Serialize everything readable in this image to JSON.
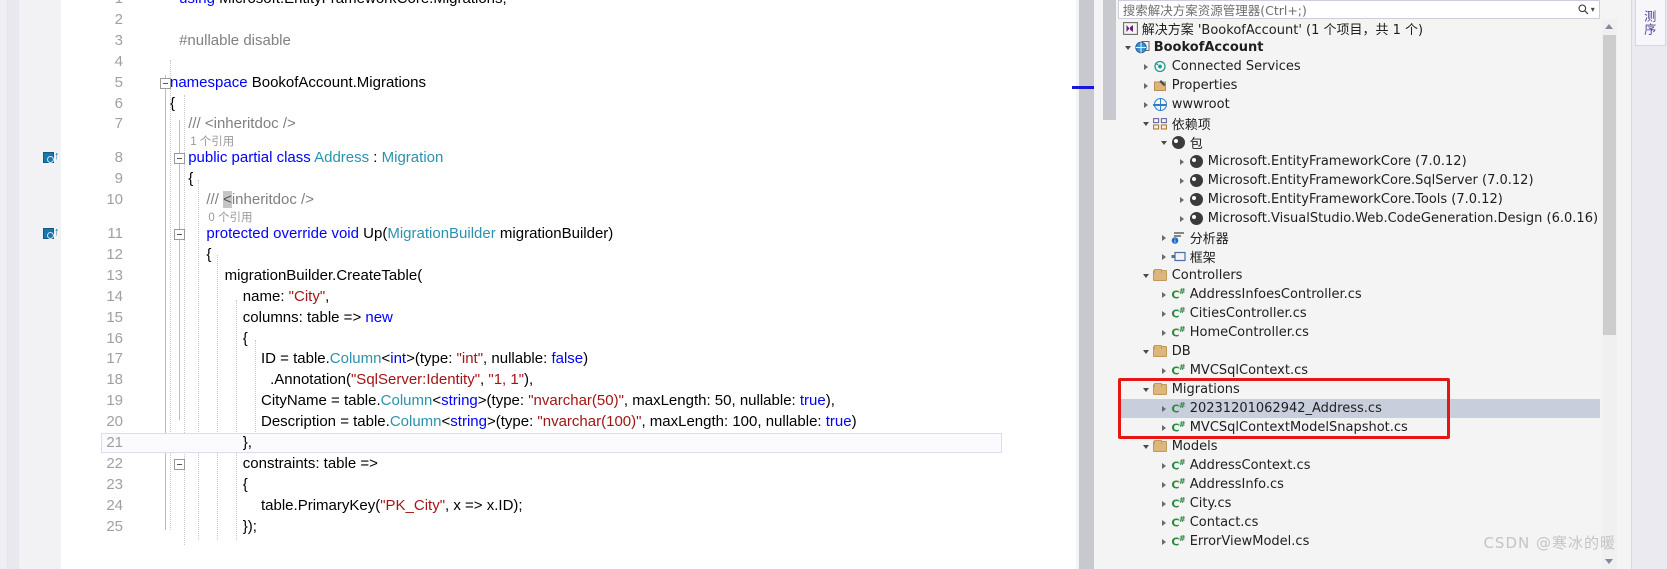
{
  "editor": {
    "first_line_number": 1,
    "lines": [
      {
        "n": "1",
        "kind": "partial-top",
        "tokens": [
          {
            "t": "using",
            "c": "kw"
          },
          {
            "t": " Microsoft.EntityFrameworkCore.Migrations;",
            "c": "pl"
          }
        ]
      },
      {
        "n": "2",
        "tokens": []
      },
      {
        "n": "3",
        "tokens": [
          {
            "t": "#nullable disable",
            "c": "pp"
          }
        ]
      },
      {
        "n": "4",
        "tokens": []
      },
      {
        "n": "5",
        "tokens": [
          {
            "t": "namespace",
            "c": "kw"
          },
          {
            "t": " BookofAccount.Migrations",
            "c": "pl"
          }
        ]
      },
      {
        "n": "6",
        "tokens": [
          {
            "t": "{",
            "c": "pl"
          }
        ]
      },
      {
        "n": "7",
        "tokens": [
          {
            "t": "/// <inheritdoc />",
            "c": "cmt"
          }
        ]
      },
      {
        "n": "8",
        "tokens": [
          {
            "t": "public partial class",
            "c": "kw"
          },
          {
            "t": " ",
            "c": "pl"
          },
          {
            "t": "Address",
            "c": "typ"
          },
          {
            "t": " : ",
            "c": "pl"
          },
          {
            "t": "Migration",
            "c": "typ"
          }
        ]
      },
      {
        "n": "9",
        "tokens": [
          {
            "t": "{",
            "c": "pl"
          }
        ]
      },
      {
        "n": "10",
        "tokens": [
          {
            "t": "/// ",
            "c": "cmt"
          },
          {
            "t": "<",
            "c": "sel-sq"
          },
          {
            "t": "inheritdoc />",
            "c": "cmt"
          }
        ]
      },
      {
        "n": "11",
        "tokens": [
          {
            "t": "protected override void",
            "c": "kw"
          },
          {
            "t": " ",
            "c": "pl"
          },
          {
            "t": "Up",
            "c": "pl"
          },
          {
            "t": "(",
            "c": "pl"
          },
          {
            "t": "MigrationBuilder",
            "c": "typ"
          },
          {
            "t": " migrationBuilder)",
            "c": "pl"
          }
        ]
      },
      {
        "n": "12",
        "tokens": [
          {
            "t": "{",
            "c": "pl"
          }
        ]
      },
      {
        "n": "13",
        "tokens": [
          {
            "t": "migrationBuilder.CreateTable(",
            "c": "pl"
          }
        ]
      },
      {
        "n": "14",
        "tokens": [
          {
            "t": "name: ",
            "c": "pl"
          },
          {
            "t": "\"City\"",
            "c": "str"
          },
          {
            "t": ",",
            "c": "pl"
          }
        ]
      },
      {
        "n": "15",
        "tokens": [
          {
            "t": "columns: table => ",
            "c": "pl"
          },
          {
            "t": "new",
            "c": "kw"
          }
        ]
      },
      {
        "n": "16",
        "tokens": [
          {
            "t": "{",
            "c": "pl"
          }
        ]
      },
      {
        "n": "17",
        "tokens": [
          {
            "t": "ID = table.",
            "c": "pl"
          },
          {
            "t": "Column",
            "c": "typ"
          },
          {
            "t": "<",
            "c": "pl"
          },
          {
            "t": "int",
            "c": "kw"
          },
          {
            "t": ">(type: ",
            "c": "pl"
          },
          {
            "t": "\"int\"",
            "c": "str"
          },
          {
            "t": ", nullable: ",
            "c": "pl"
          },
          {
            "t": "false",
            "c": "kw"
          },
          {
            "t": ")",
            "c": "pl"
          }
        ]
      },
      {
        "n": "18",
        "tokens": [
          {
            "t": ".Annotation(",
            "c": "pl"
          },
          {
            "t": "\"SqlServer:Identity\"",
            "c": "str"
          },
          {
            "t": ", ",
            "c": "pl"
          },
          {
            "t": "\"1, 1\"",
            "c": "str"
          },
          {
            "t": "),",
            "c": "pl"
          }
        ]
      },
      {
        "n": "19",
        "tokens": [
          {
            "t": "CityName = table.",
            "c": "pl"
          },
          {
            "t": "Column",
            "c": "typ"
          },
          {
            "t": "<",
            "c": "pl"
          },
          {
            "t": "string",
            "c": "kw"
          },
          {
            "t": ">(type: ",
            "c": "pl"
          },
          {
            "t": "\"nvarchar(50)\"",
            "c": "str"
          },
          {
            "t": ", maxLength: 50, nullable: ",
            "c": "pl"
          },
          {
            "t": "true",
            "c": "kw"
          },
          {
            "t": "),",
            "c": "pl"
          }
        ]
      },
      {
        "n": "20",
        "tokens": [
          {
            "t": "Description = table.",
            "c": "pl"
          },
          {
            "t": "Column",
            "c": "typ"
          },
          {
            "t": "<",
            "c": "pl"
          },
          {
            "t": "string",
            "c": "kw"
          },
          {
            "t": ">(type: ",
            "c": "pl"
          },
          {
            "t": "\"nvarchar(100)\"",
            "c": "str"
          },
          {
            "t": ", maxLength: 100, nullable: ",
            "c": "pl"
          },
          {
            "t": "true",
            "c": "kw"
          },
          {
            "t": ")",
            "c": "pl"
          }
        ]
      },
      {
        "n": "21",
        "tokens": [
          {
            "t": "},",
            "c": "pl"
          }
        ]
      },
      {
        "n": "22",
        "tokens": [
          {
            "t": "constraints: table =>",
            "c": "pl"
          }
        ]
      },
      {
        "n": "23",
        "tokens": [
          {
            "t": "{",
            "c": "pl"
          }
        ]
      },
      {
        "n": "24",
        "tokens": [
          {
            "t": "table.PrimaryKey(",
            "c": "pl"
          },
          {
            "t": "\"PK_City\"",
            "c": "str"
          },
          {
            "t": ", x => x.ID);",
            "c": "pl"
          }
        ]
      },
      {
        "n": "25",
        "tokens": [
          {
            "t": "});",
            "c": "pl"
          }
        ]
      }
    ],
    "codelens": [
      {
        "for_line": "8",
        "text": "1 个引用"
      },
      {
        "for_line": "11",
        "text": "0 个引用"
      }
    ]
  },
  "solution_explorer": {
    "search": {
      "placeholder": "搜索解决方案资源管理器(Ctrl+;)",
      "value": ""
    },
    "solution_node": {
      "label": "解决方案 'BookofAccount' (1 个项目，共 1 个)"
    },
    "tree": [
      {
        "depth": 0,
        "twisty": "down",
        "icon": "project-icon",
        "label": "BookofAccount",
        "bold": true
      },
      {
        "depth": 1,
        "twisty": "right",
        "icon": "connected-services-icon",
        "label": "Connected Services"
      },
      {
        "depth": 1,
        "twisty": "right",
        "icon": "properties-icon",
        "label": "Properties"
      },
      {
        "depth": 1,
        "twisty": "right",
        "icon": "globe-icon",
        "label": "wwwroot"
      },
      {
        "depth": 1,
        "twisty": "down",
        "icon": "dependencies-icon",
        "label": "依赖项"
      },
      {
        "depth": 2,
        "twisty": "down",
        "icon": "package-icon",
        "label": "包"
      },
      {
        "depth": 3,
        "twisty": "right",
        "icon": "package-icon",
        "label": "Microsoft.EntityFrameworkCore (7.0.12)"
      },
      {
        "depth": 3,
        "twisty": "right",
        "icon": "package-icon",
        "label": "Microsoft.EntityFrameworkCore.SqlServer (7.0.12)"
      },
      {
        "depth": 3,
        "twisty": "right",
        "icon": "package-icon",
        "label": "Microsoft.EntityFrameworkCore.Tools (7.0.12)"
      },
      {
        "depth": 3,
        "twisty": "right",
        "icon": "package-icon",
        "label": "Microsoft.VisualStudio.Web.CodeGeneration.Design (6.0.16)"
      },
      {
        "depth": 2,
        "twisty": "right",
        "icon": "analyzer-icon",
        "label": "分析器"
      },
      {
        "depth": 2,
        "twisty": "right",
        "icon": "framework-icon",
        "label": "框架"
      },
      {
        "depth": 1,
        "twisty": "down",
        "icon": "folder-icon",
        "label": "Controllers"
      },
      {
        "depth": 2,
        "twisty": "right",
        "icon": "csharp-icon",
        "label": "AddressInfoesController.cs"
      },
      {
        "depth": 2,
        "twisty": "right",
        "icon": "csharp-icon",
        "label": "CitiesController.cs"
      },
      {
        "depth": 2,
        "twisty": "right",
        "icon": "csharp-icon",
        "label": "HomeController.cs"
      },
      {
        "depth": 1,
        "twisty": "down",
        "icon": "folder-icon",
        "label": "DB"
      },
      {
        "depth": 2,
        "twisty": "right",
        "icon": "csharp-icon",
        "label": "MVCSqlContext.cs"
      },
      {
        "depth": 1,
        "twisty": "down",
        "icon": "folder-icon",
        "label": "Migrations"
      },
      {
        "depth": 2,
        "twisty": "right",
        "icon": "csharp-icon",
        "label": "20231201062942_Address.cs",
        "selected": true
      },
      {
        "depth": 2,
        "twisty": "right",
        "icon": "csharp-icon",
        "label": "MVCSqlContextModelSnapshot.cs"
      },
      {
        "depth": 1,
        "twisty": "down",
        "icon": "folder-icon",
        "label": "Models"
      },
      {
        "depth": 2,
        "twisty": "right",
        "icon": "csharp-icon",
        "label": "AddressContext.cs"
      },
      {
        "depth": 2,
        "twisty": "right",
        "icon": "csharp-icon",
        "label": "AddressInfo.cs"
      },
      {
        "depth": 2,
        "twisty": "right",
        "icon": "csharp-icon",
        "label": "City.cs"
      },
      {
        "depth": 2,
        "twisty": "right",
        "icon": "csharp-icon",
        "label": "Contact.cs"
      },
      {
        "depth": 2,
        "twisty": "right",
        "icon": "csharp-icon",
        "label": "ErrorViewModel.cs"
      }
    ],
    "highlight_color": "#e81515"
  },
  "right_tabs": [
    {
      "label": "测序",
      "name": "vertical-tool-tab"
    }
  ],
  "watermark": {
    "text": "CSDN @寒冰的暖"
  }
}
